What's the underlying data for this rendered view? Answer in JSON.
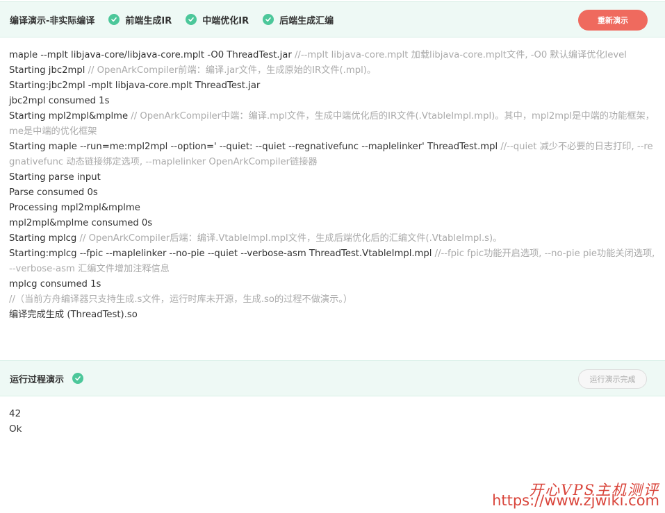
{
  "compile": {
    "title": "编译演示-非实际编译",
    "steps": [
      {
        "label": "前端生成IR",
        "icon": "check-circle-icon",
        "done": true
      },
      {
        "label": "中端优化IR",
        "icon": "check-circle-icon",
        "done": true
      },
      {
        "label": "后端生成汇编",
        "icon": "check-circle-icon",
        "done": true
      }
    ],
    "replay_button": "重新演示",
    "log": [
      {
        "cmd": "maple --mplt libjava-core/libjava-core.mplt -O0 ThreadTest.jar ",
        "comment": "//--mplt libjava-core.mplt 加载libjava-core.mplt文件, -O0 默认编译优化level"
      },
      {
        "cmd": "Starting jbc2mpl ",
        "comment": "// OpenArkCompiler前端：编译.jar文件，生成原始的IR文件(.mpl)。"
      },
      {
        "cmd": "Starting:jbc2mpl -mplt libjava-core.mplt ThreadTest.jar",
        "comment": ""
      },
      {
        "cmd": "jbc2mpl consumed 1s",
        "comment": ""
      },
      {
        "cmd": "Starting mpl2mpl&mplme ",
        "comment": "// OpenArkCompiler中端：编译.mpl文件，生成中端优化后的IR文件(.VtableImpl.mpl)。其中，mpl2mpl是中端的功能框架，me是中端的优化框架"
      },
      {
        "cmd": "Starting maple --run=me:mpl2mpl --option=' --quiet: --quiet --regnativefunc --maplelinker' ThreadTest.mpl ",
        "comment": "//--quiet 减少不必要的日志打印, --regnativefunc 动态链接绑定选项, --maplelinker OpenArkCompiler链接器"
      },
      {
        "cmd": "Starting parse input",
        "comment": ""
      },
      {
        "cmd": "Parse consumed 0s",
        "comment": ""
      },
      {
        "cmd": "Processing mpl2mpl&mplme",
        "comment": ""
      },
      {
        "cmd": "mpl2mpl&mplme consumed 0s",
        "comment": ""
      },
      {
        "cmd": "Starting mplcg ",
        "comment": "// OpenArkCompiler后端：编译.VtableImpl.mpl文件，生成后端优化后的汇编文件(.VtableImpl.s)。"
      },
      {
        "cmd": "Starting:mplcg --fpic --maplelinker --no-pie --quiet --verbose-asm ThreadTest.VtableImpl.mpl ",
        "comment": "//--fpic fpic功能开启选项, --no-pie pie功能关闭选项, --verbose-asm 汇编文件增加注释信息"
      },
      {
        "cmd": "mplcg consumed 1s",
        "comment": ""
      },
      {
        "cmd": "",
        "comment": "//（当前方舟编译器只支持生成.s文件，运行时库未开源，生成.so的过程不做演示。）"
      },
      {
        "cmd": "编译完成生成 (ThreadTest).so",
        "comment": ""
      }
    ]
  },
  "run": {
    "title": "运行过程演示",
    "icon": "check-circle-icon",
    "done_button": "运行演示完成",
    "output": [
      "42",
      "Ok"
    ]
  },
  "watermark": {
    "cn": "开心VPS主机测评",
    "url": "https://www.zjwiki.com"
  },
  "colors": {
    "header_bg": "#eef9f5",
    "check": "#4cc79a",
    "replay_button": "#ef6a5e",
    "comment": "#aaaaaa",
    "watermark": "#d9443a"
  }
}
